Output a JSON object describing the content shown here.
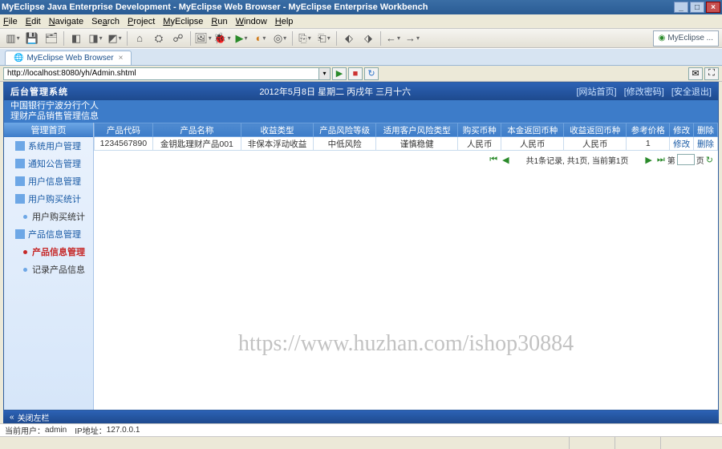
{
  "window": {
    "title": "MyEclipse Java Enterprise Development - MyEclipse Web Browser - MyEclipse Enterprise Workbench"
  },
  "menu": {
    "items": [
      "File",
      "Edit",
      "Navigate",
      "Search",
      "Project",
      "MyEclipse",
      "Run",
      "Window",
      "Help"
    ]
  },
  "toolbar": {
    "chip": "MyEclipse ..."
  },
  "tab": {
    "label": "MyEclipse Web Browser"
  },
  "address": {
    "url": "http://localhost:8080/yh/Admin.shtml",
    "go_icon": "▶",
    "stop_icon": "■",
    "refresh_icon": "↻"
  },
  "app": {
    "brand": "后台管理系统",
    "sub1": "中国银行宁波分行个人",
    "sub2": "理财产品销售管理信息",
    "date": "2012年5月8日  星期二  丙戌年  三月十六",
    "links": {
      "home": "[网站首页]",
      "pwd": "[修改密码]",
      "exit": "[安全退出]"
    }
  },
  "sidebar": {
    "head": "管理首页",
    "items": [
      {
        "label": "系统用户管理",
        "type": "top"
      },
      {
        "label": "通知公告管理",
        "type": "top"
      },
      {
        "label": "用户信息管理",
        "type": "top"
      },
      {
        "label": "用户购买统计",
        "type": "top"
      },
      {
        "label": "用户购买统计",
        "type": "sub"
      },
      {
        "label": "产品信息管理",
        "type": "top"
      },
      {
        "label": "产品信息管理",
        "type": "active"
      },
      {
        "label": "记录产品信息",
        "type": "sub"
      }
    ]
  },
  "grid": {
    "headers": [
      "产品代码",
      "产品名称",
      "收益类型",
      "产品风险等级",
      "适用客户风险类型",
      "购买币种",
      "本金返回币种",
      "收益返回币种",
      "参考价格",
      "修改",
      "删除"
    ],
    "row": {
      "code": "1234567890",
      "name": "金钥匙理财产品001",
      "profit_type": "非保本浮动收益",
      "risk_level": "中低风险",
      "cust_risk": "谨慎稳健",
      "buy_cur": "人民币",
      "principal_cur": "人民币",
      "return_cur": "人民币",
      "ref_price": "1",
      "edit": "修改",
      "del": "删除"
    }
  },
  "pager": {
    "summary": "共1条记录, 共1页, 当前第1页",
    "page_label_a": "第",
    "page_label_b": "页"
  },
  "collapse": {
    "label": "关闭左栏"
  },
  "status": {
    "user_prefix": "当前用户：",
    "user": "admin",
    "ip_prefix": "IP地址：",
    "ip": "127.0.0.1"
  },
  "watermark": "https://www.huzhan.com/ishop30884"
}
